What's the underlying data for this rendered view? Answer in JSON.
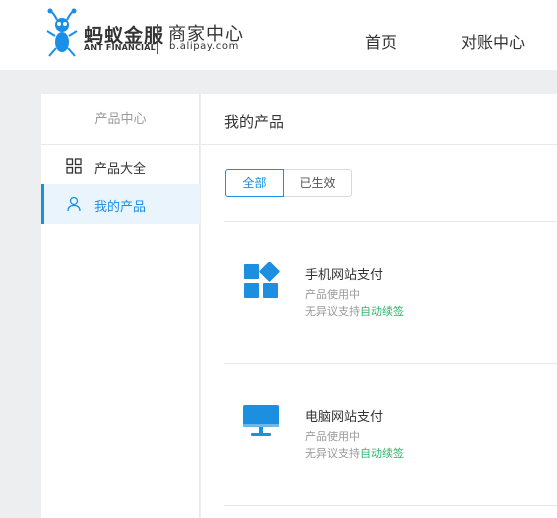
{
  "header": {
    "brand_cn": "蚂蚁金服",
    "brand_en": "ANT FINANCIAL",
    "merchant_title": "商家中心",
    "merchant_url": "b.alipay.com",
    "nav": [
      "首页",
      "对账中心"
    ]
  },
  "sidebar": {
    "title": "产品中心",
    "items": [
      {
        "label": "产品大全",
        "icon": "grid-icon",
        "active": false
      },
      {
        "label": "我的产品",
        "icon": "user-icon",
        "active": true
      }
    ]
  },
  "main": {
    "title": "我的产品",
    "filters": [
      {
        "label": "全部",
        "selected": true
      },
      {
        "label": "已生效",
        "selected": false
      }
    ],
    "products": [
      {
        "name": "手机网站支付",
        "status": "产品使用中",
        "note_prefix": "无异议支持",
        "note_link": "自动续签",
        "icon": "mobile-pay-icon"
      },
      {
        "name": "电脑网站支付",
        "status": "产品使用中",
        "note_prefix": "无异议支持",
        "note_link": "自动续签",
        "icon": "monitor-pay-icon"
      }
    ]
  },
  "colors": {
    "accent": "#1a8fe8",
    "active_bg": "#eaf4fd",
    "green": "#2fb36b",
    "page_bg": "#eceeef",
    "icon_blue": "#1d8fe0"
  }
}
